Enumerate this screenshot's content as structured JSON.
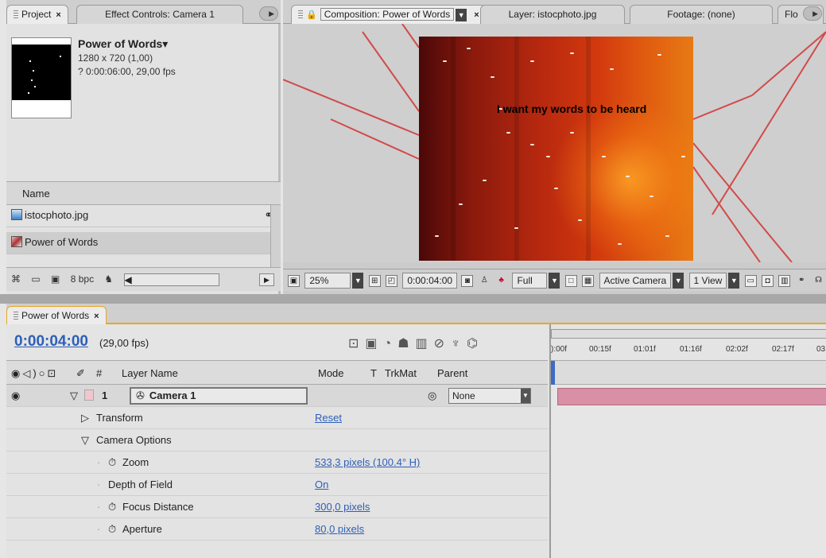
{
  "project": {
    "tab_project": "Project",
    "tab_effect": "Effect Controls: Camera 1",
    "comp_title": "Power of Words▾",
    "comp_size": "1280 x 720 (1,00)",
    "comp_duration": "? 0:00:06:00, 29,00 fps",
    "name_header": "Name",
    "items": [
      {
        "label": "istocphoto.jpg"
      },
      {
        "label": "Power of Words"
      }
    ],
    "bpc": "8 bpc"
  },
  "comp": {
    "tabs": [
      {
        "label": "Composition: Power of Words"
      },
      {
        "label": "Layer: istocphoto.jpg"
      },
      {
        "label": "Footage: (none)"
      },
      {
        "label": "Flo"
      }
    ],
    "frame_text": "I want my words to be heard",
    "zoom": "25%",
    "timecode": "0:00:04:00",
    "resolution": "Full",
    "camera": "Active Camera",
    "views": "1 View"
  },
  "timeline": {
    "tab": "Power of Words",
    "timecode": "0:00:04:00",
    "fps": "(29,00 fps)",
    "columns": {
      "layer_name": "Layer Name",
      "mode": "Mode",
      "t": "T",
      "trkmat": "TrkMat",
      "parent": "Parent",
      "num": "#"
    },
    "layer": {
      "index": "1",
      "name": "Camera 1",
      "parent": "None"
    },
    "properties": [
      {
        "name": "Transform",
        "value": "Reset"
      },
      {
        "name": "Camera Options",
        "value": ""
      },
      {
        "name": "Zoom",
        "value": "533,3 pixels (100.4° H)"
      },
      {
        "name": "Depth of Field",
        "value": "On"
      },
      {
        "name": "Focus Distance",
        "value": "300,0 pixels"
      },
      {
        "name": "Aperture",
        "value": "80,0 pixels"
      }
    ],
    "ruler_ticks": [
      "):00f",
      "00:15f",
      "01:01f",
      "01:16f",
      "02:02f",
      "02:17f",
      "03:"
    ]
  },
  "colors": {
    "accent_blue": "#2d5fb8",
    "timeline_accent": "#e8a820",
    "layer_bar": "#d98fa5"
  }
}
